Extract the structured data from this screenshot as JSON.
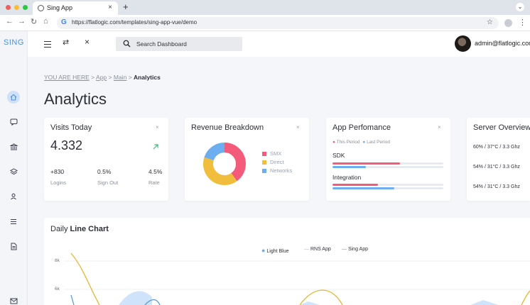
{
  "browser": {
    "tab_title": "Sing App",
    "tab_close": "×",
    "new_tab": "+",
    "url": "https://flatlogic.com/templates/sing-app-vue/demo",
    "g_icon": "G"
  },
  "sidebar": {
    "logo": "SING",
    "icons": [
      "home-icon",
      "chat-icon",
      "bank-icon",
      "layers-icon",
      "user-icon",
      "list-icon",
      "document-icon",
      "mail-icon"
    ]
  },
  "header": {
    "search_placeholder": "Search Dashboard",
    "user": "admin@flatlogic.com"
  },
  "breadcrumb": {
    "prefix": "YOU ARE HERE",
    "sep": ">",
    "items": [
      "App",
      "Main"
    ],
    "current": "Analytics"
  },
  "page_title": "Analytics",
  "visits": {
    "title": "Visits Today",
    "value": "4.332",
    "stats": [
      {
        "value": "+830",
        "label": "Logins"
      },
      {
        "value": "0.5%",
        "label": "Sign Out"
      },
      {
        "value": "4.5%",
        "label": "Rate"
      }
    ]
  },
  "revenue": {
    "title": "Revenue Breakdown",
    "legend": [
      "SMX",
      "Direct",
      "Networks"
    ],
    "colors": [
      "#f45b7a",
      "#f1bd3c",
      "#6daef0"
    ]
  },
  "perf": {
    "title": "App Perfomance",
    "legend_this": "This Period",
    "legend_last": "Last Period",
    "rows": [
      {
        "label": "SDK",
        "this": 0.61,
        "last": 0.3
      },
      {
        "label": "Integration",
        "this": 0.41,
        "last": 0.56
      }
    ],
    "colors": {
      "this": "#f45b7a",
      "last": "#6daef0"
    }
  },
  "server": {
    "title": "Server Overview",
    "rows": [
      "60% / 37°C / 3.3 Ghz",
      "54% / 31°C / 3.3 Ghz",
      "54% / 31°C / 3.3 Ghz"
    ]
  },
  "close_glyph": "×",
  "chart_data": {
    "type": "line",
    "title": "Daily Line Chart",
    "series": [
      {
        "name": "Light Blue",
        "color": "#6daef0"
      },
      {
        "name": "RNS App",
        "color": "#e9b632"
      },
      {
        "name": "Sing App",
        "color": "#5b9ad8"
      }
    ],
    "y_ticks": [
      "8k",
      "6k"
    ]
  }
}
